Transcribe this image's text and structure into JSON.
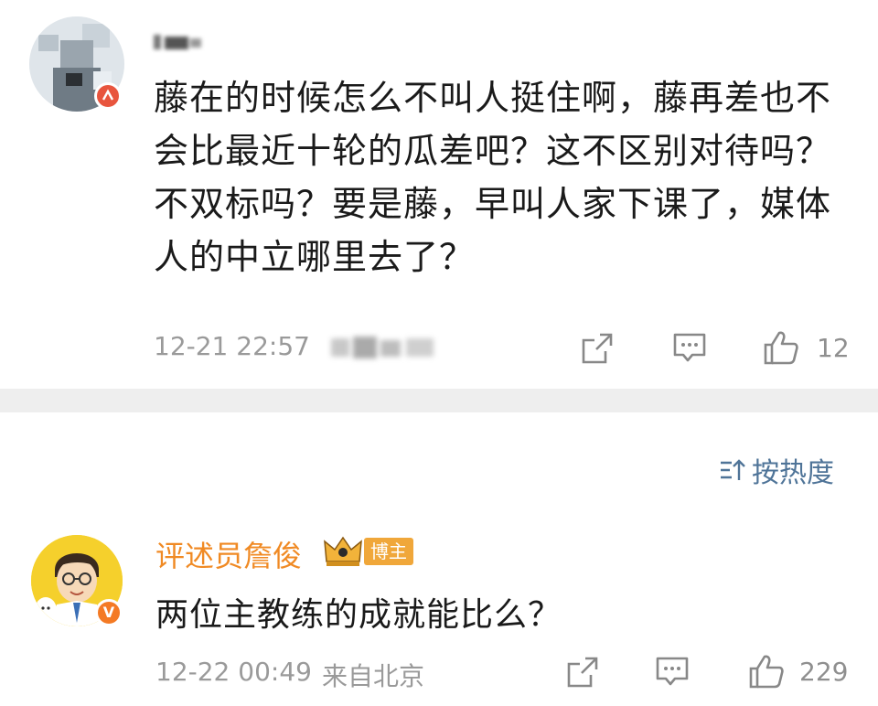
{
  "comment1": {
    "text": "藤在的时候怎么不叫人挺住啊，藤再差也不会比最近十轮的瓜差吧？这不区别对待吗？不双标吗？要是藤，早叫人家下课了，媒体人的中立哪里去了？",
    "timestamp": "12-21 22:57",
    "like_count": "12"
  },
  "sort": {
    "label": "按热度"
  },
  "comment2": {
    "username": "评述员詹俊",
    "role_badge": "博主",
    "text": "两位主教练的成就能比么？",
    "timestamp": "12-22 00:49",
    "location": "来自北京",
    "like_count": "229"
  },
  "icons": [
    "share-icon",
    "comment-icon",
    "like-icon",
    "sort-icon",
    "crown-icon"
  ],
  "colors": {
    "username_orange": "#f08a24",
    "link_blue": "#4f7498",
    "divider_gray": "#eeeeee",
    "meta_gray": "#9a9a9a"
  }
}
